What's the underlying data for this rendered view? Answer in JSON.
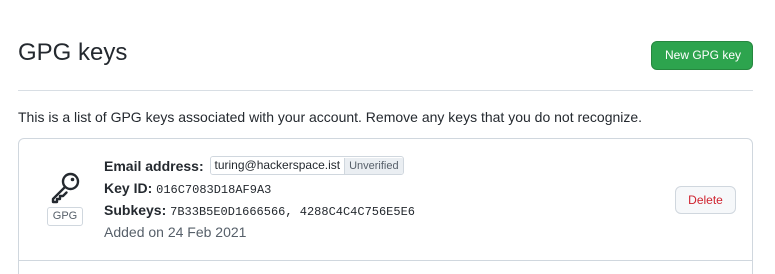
{
  "header": {
    "title": "GPG keys",
    "new_key_button": "New GPG key"
  },
  "description": "This is a list of GPG keys associated with your account. Remove any keys that you do not recognize.",
  "keys": [
    {
      "badge": "GPG",
      "icon": "key-icon",
      "email_label": "Email address:",
      "email": "turing@hackerspace.ist",
      "status": "Unverified",
      "key_id_label": "Key ID:",
      "key_id": "016C7083D18AF9A3",
      "subkeys_label": "Subkeys:",
      "subkeys": "7B33B5E0D1666566, 4288C4C4C756E5E6",
      "added": "Added on 24 Feb 2021",
      "delete_label": "Delete"
    }
  ],
  "colors": {
    "primary_button": "#2da44e",
    "danger_text": "#cf222e",
    "border": "#d0d7de"
  }
}
